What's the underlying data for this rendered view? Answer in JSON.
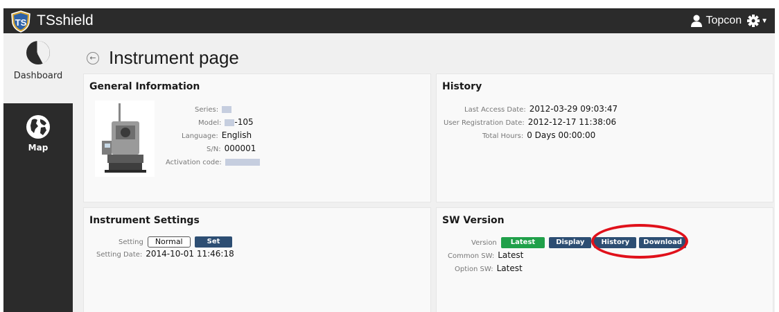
{
  "app": {
    "name": "TSshield",
    "logo_text": "TS"
  },
  "user": {
    "name": "Topcon"
  },
  "sidebar": {
    "items": [
      {
        "label": "Dashboard"
      },
      {
        "label": "Map"
      }
    ]
  },
  "page": {
    "title": "Instrument page"
  },
  "general": {
    "title": "General Information",
    "series_label": "Series:",
    "model_label": "Model:",
    "model_suffix": "-105",
    "language_label": "Language:",
    "language_value": "English",
    "sn_label": "S/N:",
    "sn_value": "000001",
    "activation_label": "Activation code:"
  },
  "history": {
    "title": "History",
    "last_access_label": "Last Access Date:",
    "last_access_value": "2012-03-29 09:03:47",
    "registration_label": "User Registration Date:",
    "registration_value": "2012-12-17 11:38:06",
    "total_hours_label": "Total Hours:",
    "total_hours_value": "0 Days 00:00:00"
  },
  "settings": {
    "title": "Instrument Settings",
    "setting_label": "Setting",
    "setting_value": "Normal",
    "set_button": "Set",
    "date_label": "Setting Date:",
    "date_value": "2014-10-01 11:46:18"
  },
  "sw": {
    "title": "SW Version",
    "version_label": "Version",
    "latest_badge": "Latest",
    "display_button": "Display",
    "history_button": "History",
    "download_button": "Download",
    "common_label": "Common SW:",
    "common_value": "Latest",
    "option_label": "Option SW:",
    "option_value": "Latest"
  },
  "colors": {
    "topbar": "#2b2b2b",
    "button_blue": "#2d4e73",
    "badge_green": "#20a04a",
    "highlight_red": "#e0111b"
  }
}
